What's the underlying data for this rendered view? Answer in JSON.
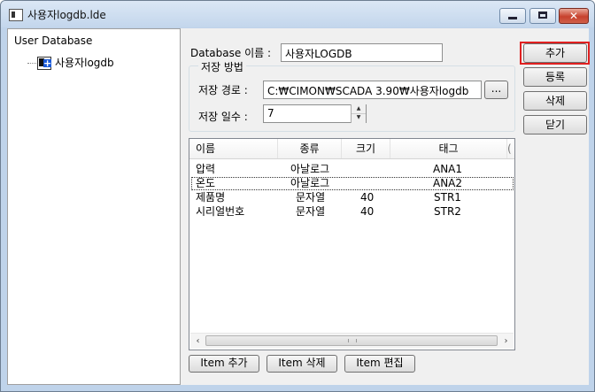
{
  "window": {
    "title": "사용자logdb.lde"
  },
  "tree": {
    "header": "User Database",
    "node_label": "사용자logdb"
  },
  "form": {
    "db_name_label": "Database 이름 :",
    "db_name_value": "사용자LOGDB",
    "storage_group_title": "저장 방법",
    "path_label": "저장 경로 :",
    "path_value": "C:₩CIMON₩SCADA 3.90₩사용자logdb",
    "browse_label": "...",
    "days_label": "저장 일수 :",
    "days_value": "7"
  },
  "table": {
    "columns": [
      "이름",
      "종류",
      "크기",
      "태그"
    ],
    "rows": [
      {
        "name": "압력",
        "type": "아날로그",
        "size": "",
        "tag": "ANA1"
      },
      {
        "name": "온도",
        "type": "아날로그",
        "size": "",
        "tag": "ANA2"
      },
      {
        "name": "제품명",
        "type": "문자열",
        "size": "40",
        "tag": "STR1"
      },
      {
        "name": "시리얼번호",
        "type": "문자열",
        "size": "40",
        "tag": "STR2"
      }
    ]
  },
  "item_buttons": {
    "add": "Item 추가",
    "delete": "Item 삭제",
    "edit": "Item 편집"
  },
  "side_buttons": {
    "add": "추가",
    "register": "등록",
    "delete": "삭제",
    "close": "닫기"
  },
  "colors": {
    "highlight": "#e02020",
    "node_icon_accent": "#1c5bd8"
  }
}
